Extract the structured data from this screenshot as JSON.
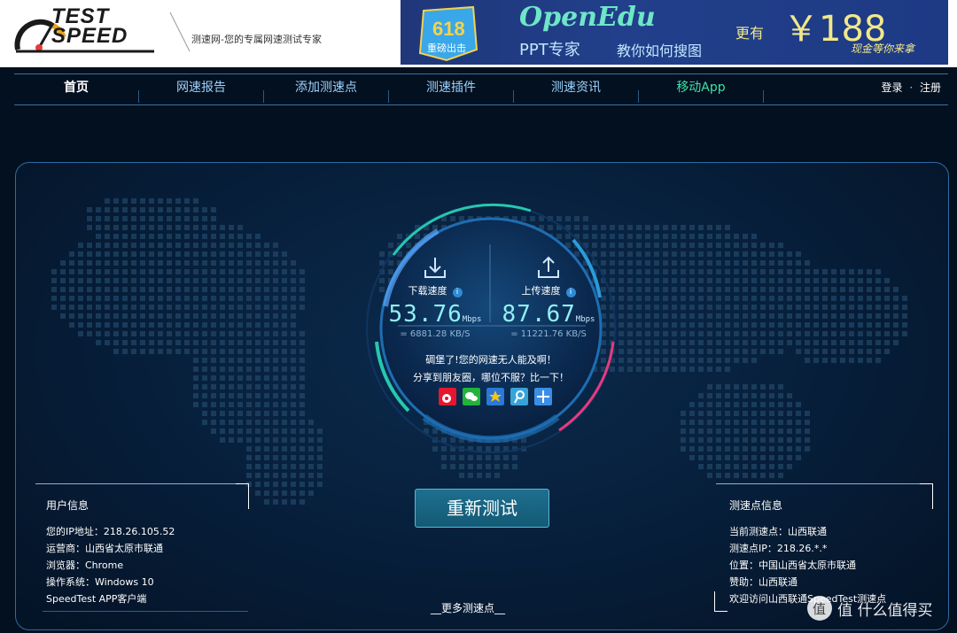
{
  "header": {
    "logo_line1": "TEST",
    "logo_line2": "SPEED",
    "slogan": "测速网-您的专属网速测试专家"
  },
  "banner": {
    "badge": "618",
    "badge_sub": "重磅出击",
    "title": "OpenEdu",
    "subtitle": "PPT专家",
    "subtitle2": "教你如何搜图",
    "more": "更有",
    "price": "￥188",
    "note": "现金等你来拿"
  },
  "nav": {
    "items": [
      "首页",
      "网速报告",
      "添加测速点",
      "测速插件",
      "测速资讯",
      "移动App"
    ],
    "login": "登录",
    "dot": "·",
    "register": "注册"
  },
  "speed": {
    "download": {
      "label": "下载速度",
      "info": "i",
      "value": "53.76",
      "unit": "Mbps",
      "sub": "= 6881.28 KB/S"
    },
    "upload": {
      "label": "上传速度",
      "info": "i",
      "value": "87.67",
      "unit": "Mbps",
      "sub": "= 11221.76 KB/S"
    },
    "message1": "碉堡了!您的网速无人能及啊！",
    "message2": "分享到朋友圈，哪位不服？比一下！"
  },
  "share": {
    "icons": [
      "weibo-icon",
      "wechat-icon",
      "qzone-icon",
      "tencent-weibo-icon",
      "more-share-icon"
    ]
  },
  "retest_label": "重新测试",
  "more_nodes": "__更多测速点__",
  "user_info": {
    "title": "用户信息",
    "rows": [
      [
        "您的IP地址：",
        "218.26.105.52"
      ],
      [
        "运营商：",
        "山西省太原市联通"
      ],
      [
        "浏览器：",
        "Chrome"
      ],
      [
        "操作系统：",
        "Windows 10"
      ]
    ],
    "app_client": "SpeedTest APP客户端"
  },
  "node_info": {
    "title": "测速点信息",
    "rows": [
      [
        "当前测速点：",
        "山西联通"
      ],
      [
        "测速点IP：",
        "218.26.*.*"
      ],
      [
        "位置：",
        "中国山西省太原市联通"
      ],
      [
        "赞助：",
        "山西联通"
      ]
    ],
    "welcome": "欢迎访问山西联通SpeedTest测速点"
  },
  "watermark": "值 什么值得买",
  "colors": {
    "accent_cyan": "#8ff0f2",
    "nav_active_app": "#41e0a7",
    "arc_pink": "#e83a7e",
    "arc_teal": "#26c7b0",
    "arc_blue": "#2a9bdc"
  }
}
